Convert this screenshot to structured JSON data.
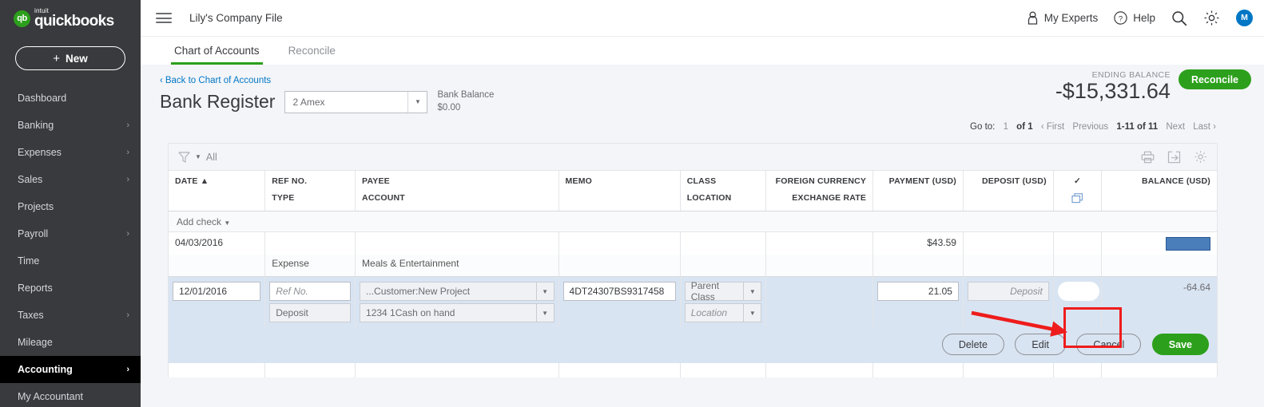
{
  "brand": {
    "logo_intuit": "intuit",
    "logo_name": "quickbooks",
    "accent_green": "#2ca01c",
    "link_blue": "#0077c5"
  },
  "sidebar": {
    "new_button": {
      "label": "New",
      "plus": "+"
    },
    "items": [
      {
        "label": "Dashboard",
        "chevron": ""
      },
      {
        "label": "Banking",
        "chevron": "›"
      },
      {
        "label": "Expenses",
        "chevron": "›"
      },
      {
        "label": "Sales",
        "chevron": "›"
      },
      {
        "label": "Projects",
        "chevron": ""
      },
      {
        "label": "Payroll",
        "chevron": "›"
      },
      {
        "label": "Time",
        "chevron": ""
      },
      {
        "label": "Reports",
        "chevron": ""
      },
      {
        "label": "Taxes",
        "chevron": "›"
      },
      {
        "label": "Mileage",
        "chevron": ""
      },
      {
        "label": "Accounting",
        "chevron": "›"
      },
      {
        "label": "My Accountant",
        "chevron": ""
      }
    ]
  },
  "topbar": {
    "company_title": "Lily's Company File",
    "my_experts": "My Experts",
    "help": "Help",
    "avatar_initial": "M"
  },
  "tabs": [
    {
      "label": "Chart of Accounts",
      "active": true
    },
    {
      "label": "Reconcile",
      "active": false
    }
  ],
  "pagehead": {
    "back_link": "Back to Chart of Accounts",
    "back_chevron": "‹",
    "title": "Bank Register",
    "account_value": "2 Amex",
    "bank_balance_label": "Bank Balance",
    "bank_balance_value": "$0.00",
    "ending_balance_label": "ENDING BALANCE",
    "ending_balance_value": "-$15,331.64",
    "reconcile_button": "Reconcile"
  },
  "pager": {
    "goto_label": "Go to:",
    "page_current": "1",
    "page_of": "of 1",
    "first": "‹ First",
    "previous": "Previous",
    "range": "1-11 of 11",
    "next": "Next",
    "last": "Last ›"
  },
  "register": {
    "filter_label": "All",
    "add_check": "Add check",
    "columns": [
      {
        "top": "DATE ▲",
        "sub": ""
      },
      {
        "top": "REF NO.",
        "sub": "TYPE"
      },
      {
        "top": "PAYEE",
        "sub": "ACCOUNT"
      },
      {
        "top": "MEMO",
        "sub": ""
      },
      {
        "top": "CLASS",
        "sub": "LOCATION"
      },
      {
        "top": "FOREIGN CURRENCY",
        "sub": "EXCHANGE RATE"
      },
      {
        "top": "PAYMENT (USD)",
        "sub": ""
      },
      {
        "top": "DEPOSIT (USD)",
        "sub": ""
      },
      {
        "top": "✓",
        "sub": "copy-icon"
      },
      {
        "top": "BALANCE (USD)",
        "sub": ""
      }
    ],
    "rows": [
      {
        "date": "04/03/2016",
        "ref_no": "",
        "type": "Expense",
        "payee": "",
        "account": "Meals & Entertainment",
        "memo": "",
        "class": "",
        "location": "",
        "foreign_currency": "",
        "exchange_rate": "",
        "payment": "$43.59",
        "deposit": "",
        "check": "",
        "balance_redacted": true
      }
    ],
    "edit_row": {
      "date": "12/01/2016",
      "ref_no_placeholder": "Ref No.",
      "type": "Deposit",
      "payee": "...Customer:New Project",
      "account": "1234 1Cash on hand",
      "memo": "4DT24307BS9317458",
      "class": "Parent Class",
      "location_placeholder": "Location",
      "payment": "21.05",
      "deposit_placeholder": "Deposit",
      "balance": "-64.64",
      "buttons": [
        {
          "label": "Delete",
          "primary": false
        },
        {
          "label": "Edit",
          "primary": false
        },
        {
          "label": "Cancel",
          "primary": false
        },
        {
          "label": "Save",
          "primary": true
        }
      ]
    }
  },
  "annotation": {
    "arrow_color": "#ee1c1c",
    "box_color": "#ee1c1c"
  }
}
